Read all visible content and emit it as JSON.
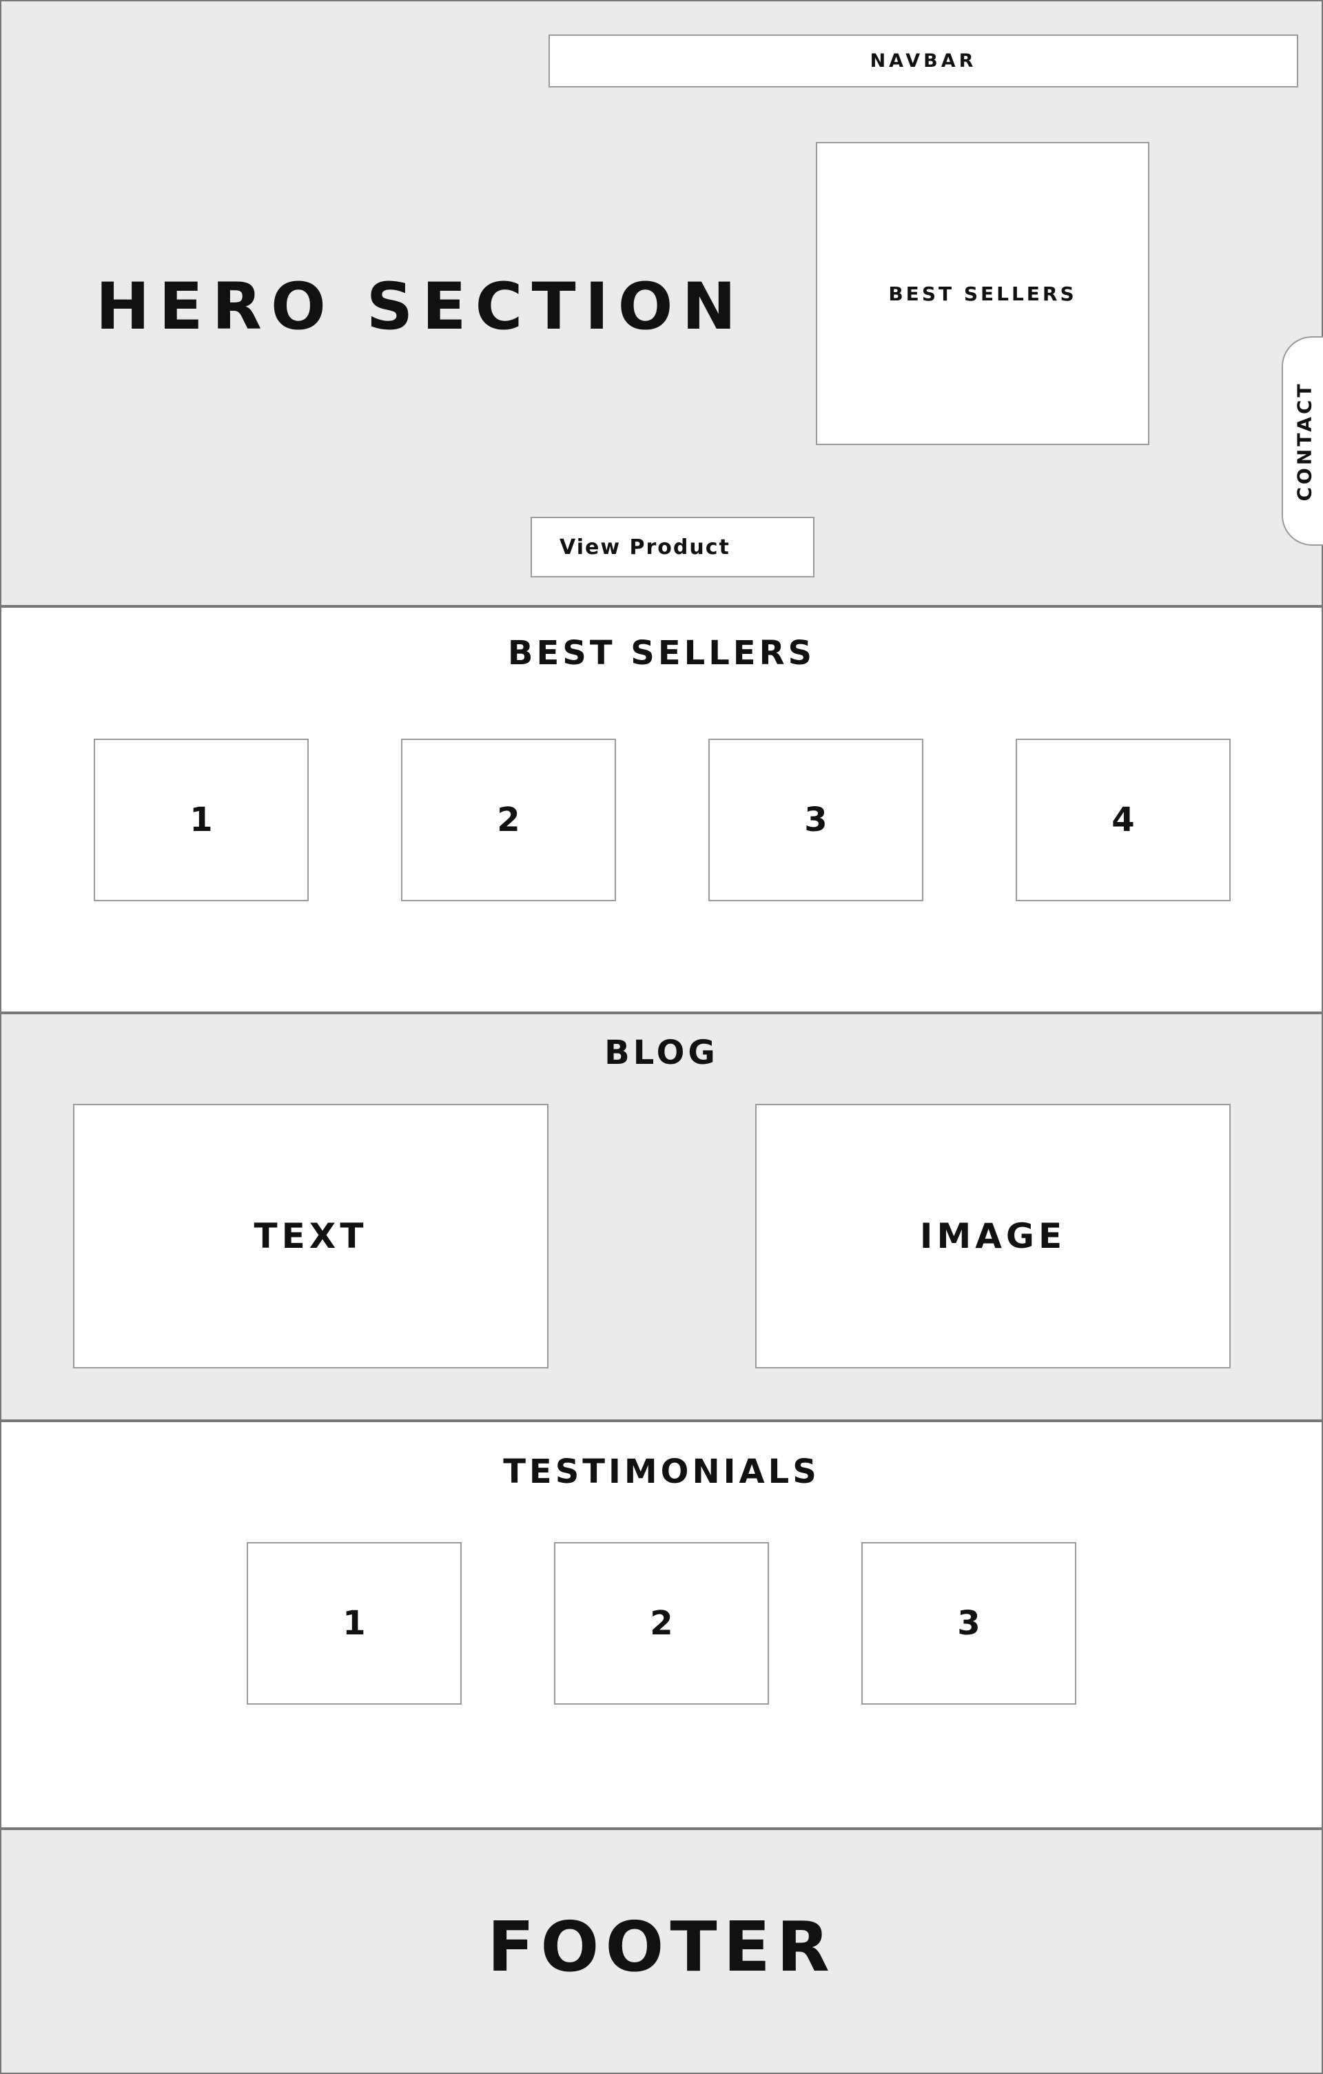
{
  "hero": {
    "navbar_label": "NAVBAR",
    "title": "HERO SECTION",
    "best_sellers_label": "BEST SELLERS",
    "view_product_label": "View Product",
    "contact_label": "CONTACT"
  },
  "best_sellers": {
    "title": "BEST SELLERS",
    "items": [
      "1",
      "2",
      "3",
      "4"
    ]
  },
  "blog": {
    "title": "BLOG",
    "text_label": "TEXT",
    "image_label": "IMAGE"
  },
  "testimonials": {
    "title": "TESTIMONIALS",
    "items": [
      "1",
      "2",
      "3"
    ]
  },
  "footer": {
    "title": "FOOTER"
  },
  "colors": {
    "grey_section": "#ebebeb",
    "white_section": "#ffffff",
    "box_border": "#9a9a9a",
    "section_border": "#777777",
    "text": "#111111"
  }
}
